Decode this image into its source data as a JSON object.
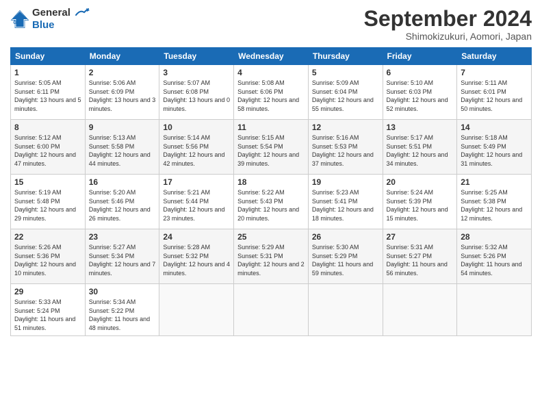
{
  "header": {
    "logo_line1": "General",
    "logo_line2": "Blue",
    "month_year": "September 2024",
    "location": "Shimokizukuri, Aomori, Japan"
  },
  "weekdays": [
    "Sunday",
    "Monday",
    "Tuesday",
    "Wednesday",
    "Thursday",
    "Friday",
    "Saturday"
  ],
  "weeks": [
    [
      {
        "day": "1",
        "sunrise": "5:05 AM",
        "sunset": "6:11 PM",
        "daylight": "13 hours and 5 minutes."
      },
      {
        "day": "2",
        "sunrise": "5:06 AM",
        "sunset": "6:09 PM",
        "daylight": "13 hours and 3 minutes."
      },
      {
        "day": "3",
        "sunrise": "5:07 AM",
        "sunset": "6:08 PM",
        "daylight": "13 hours and 0 minutes."
      },
      {
        "day": "4",
        "sunrise": "5:08 AM",
        "sunset": "6:06 PM",
        "daylight": "12 hours and 58 minutes."
      },
      {
        "day": "5",
        "sunrise": "5:09 AM",
        "sunset": "6:04 PM",
        "daylight": "12 hours and 55 minutes."
      },
      {
        "day": "6",
        "sunrise": "5:10 AM",
        "sunset": "6:03 PM",
        "daylight": "12 hours and 52 minutes."
      },
      {
        "day": "7",
        "sunrise": "5:11 AM",
        "sunset": "6:01 PM",
        "daylight": "12 hours and 50 minutes."
      }
    ],
    [
      {
        "day": "8",
        "sunrise": "5:12 AM",
        "sunset": "6:00 PM",
        "daylight": "12 hours and 47 minutes."
      },
      {
        "day": "9",
        "sunrise": "5:13 AM",
        "sunset": "5:58 PM",
        "daylight": "12 hours and 44 minutes."
      },
      {
        "day": "10",
        "sunrise": "5:14 AM",
        "sunset": "5:56 PM",
        "daylight": "12 hours and 42 minutes."
      },
      {
        "day": "11",
        "sunrise": "5:15 AM",
        "sunset": "5:54 PM",
        "daylight": "12 hours and 39 minutes."
      },
      {
        "day": "12",
        "sunrise": "5:16 AM",
        "sunset": "5:53 PM",
        "daylight": "12 hours and 37 minutes."
      },
      {
        "day": "13",
        "sunrise": "5:17 AM",
        "sunset": "5:51 PM",
        "daylight": "12 hours and 34 minutes."
      },
      {
        "day": "14",
        "sunrise": "5:18 AM",
        "sunset": "5:49 PM",
        "daylight": "12 hours and 31 minutes."
      }
    ],
    [
      {
        "day": "15",
        "sunrise": "5:19 AM",
        "sunset": "5:48 PM",
        "daylight": "12 hours and 29 minutes."
      },
      {
        "day": "16",
        "sunrise": "5:20 AM",
        "sunset": "5:46 PM",
        "daylight": "12 hours and 26 minutes."
      },
      {
        "day": "17",
        "sunrise": "5:21 AM",
        "sunset": "5:44 PM",
        "daylight": "12 hours and 23 minutes."
      },
      {
        "day": "18",
        "sunrise": "5:22 AM",
        "sunset": "5:43 PM",
        "daylight": "12 hours and 20 minutes."
      },
      {
        "day": "19",
        "sunrise": "5:23 AM",
        "sunset": "5:41 PM",
        "daylight": "12 hours and 18 minutes."
      },
      {
        "day": "20",
        "sunrise": "5:24 AM",
        "sunset": "5:39 PM",
        "daylight": "12 hours and 15 minutes."
      },
      {
        "day": "21",
        "sunrise": "5:25 AM",
        "sunset": "5:38 PM",
        "daylight": "12 hours and 12 minutes."
      }
    ],
    [
      {
        "day": "22",
        "sunrise": "5:26 AM",
        "sunset": "5:36 PM",
        "daylight": "12 hours and 10 minutes."
      },
      {
        "day": "23",
        "sunrise": "5:27 AM",
        "sunset": "5:34 PM",
        "daylight": "12 hours and 7 minutes."
      },
      {
        "day": "24",
        "sunrise": "5:28 AM",
        "sunset": "5:32 PM",
        "daylight": "12 hours and 4 minutes."
      },
      {
        "day": "25",
        "sunrise": "5:29 AM",
        "sunset": "5:31 PM",
        "daylight": "12 hours and 2 minutes."
      },
      {
        "day": "26",
        "sunrise": "5:30 AM",
        "sunset": "5:29 PM",
        "daylight": "11 hours and 59 minutes."
      },
      {
        "day": "27",
        "sunrise": "5:31 AM",
        "sunset": "5:27 PM",
        "daylight": "11 hours and 56 minutes."
      },
      {
        "day": "28",
        "sunrise": "5:32 AM",
        "sunset": "5:26 PM",
        "daylight": "11 hours and 54 minutes."
      }
    ],
    [
      {
        "day": "29",
        "sunrise": "5:33 AM",
        "sunset": "5:24 PM",
        "daylight": "11 hours and 51 minutes."
      },
      {
        "day": "30",
        "sunrise": "5:34 AM",
        "sunset": "5:22 PM",
        "daylight": "11 hours and 48 minutes."
      },
      null,
      null,
      null,
      null,
      null
    ]
  ]
}
